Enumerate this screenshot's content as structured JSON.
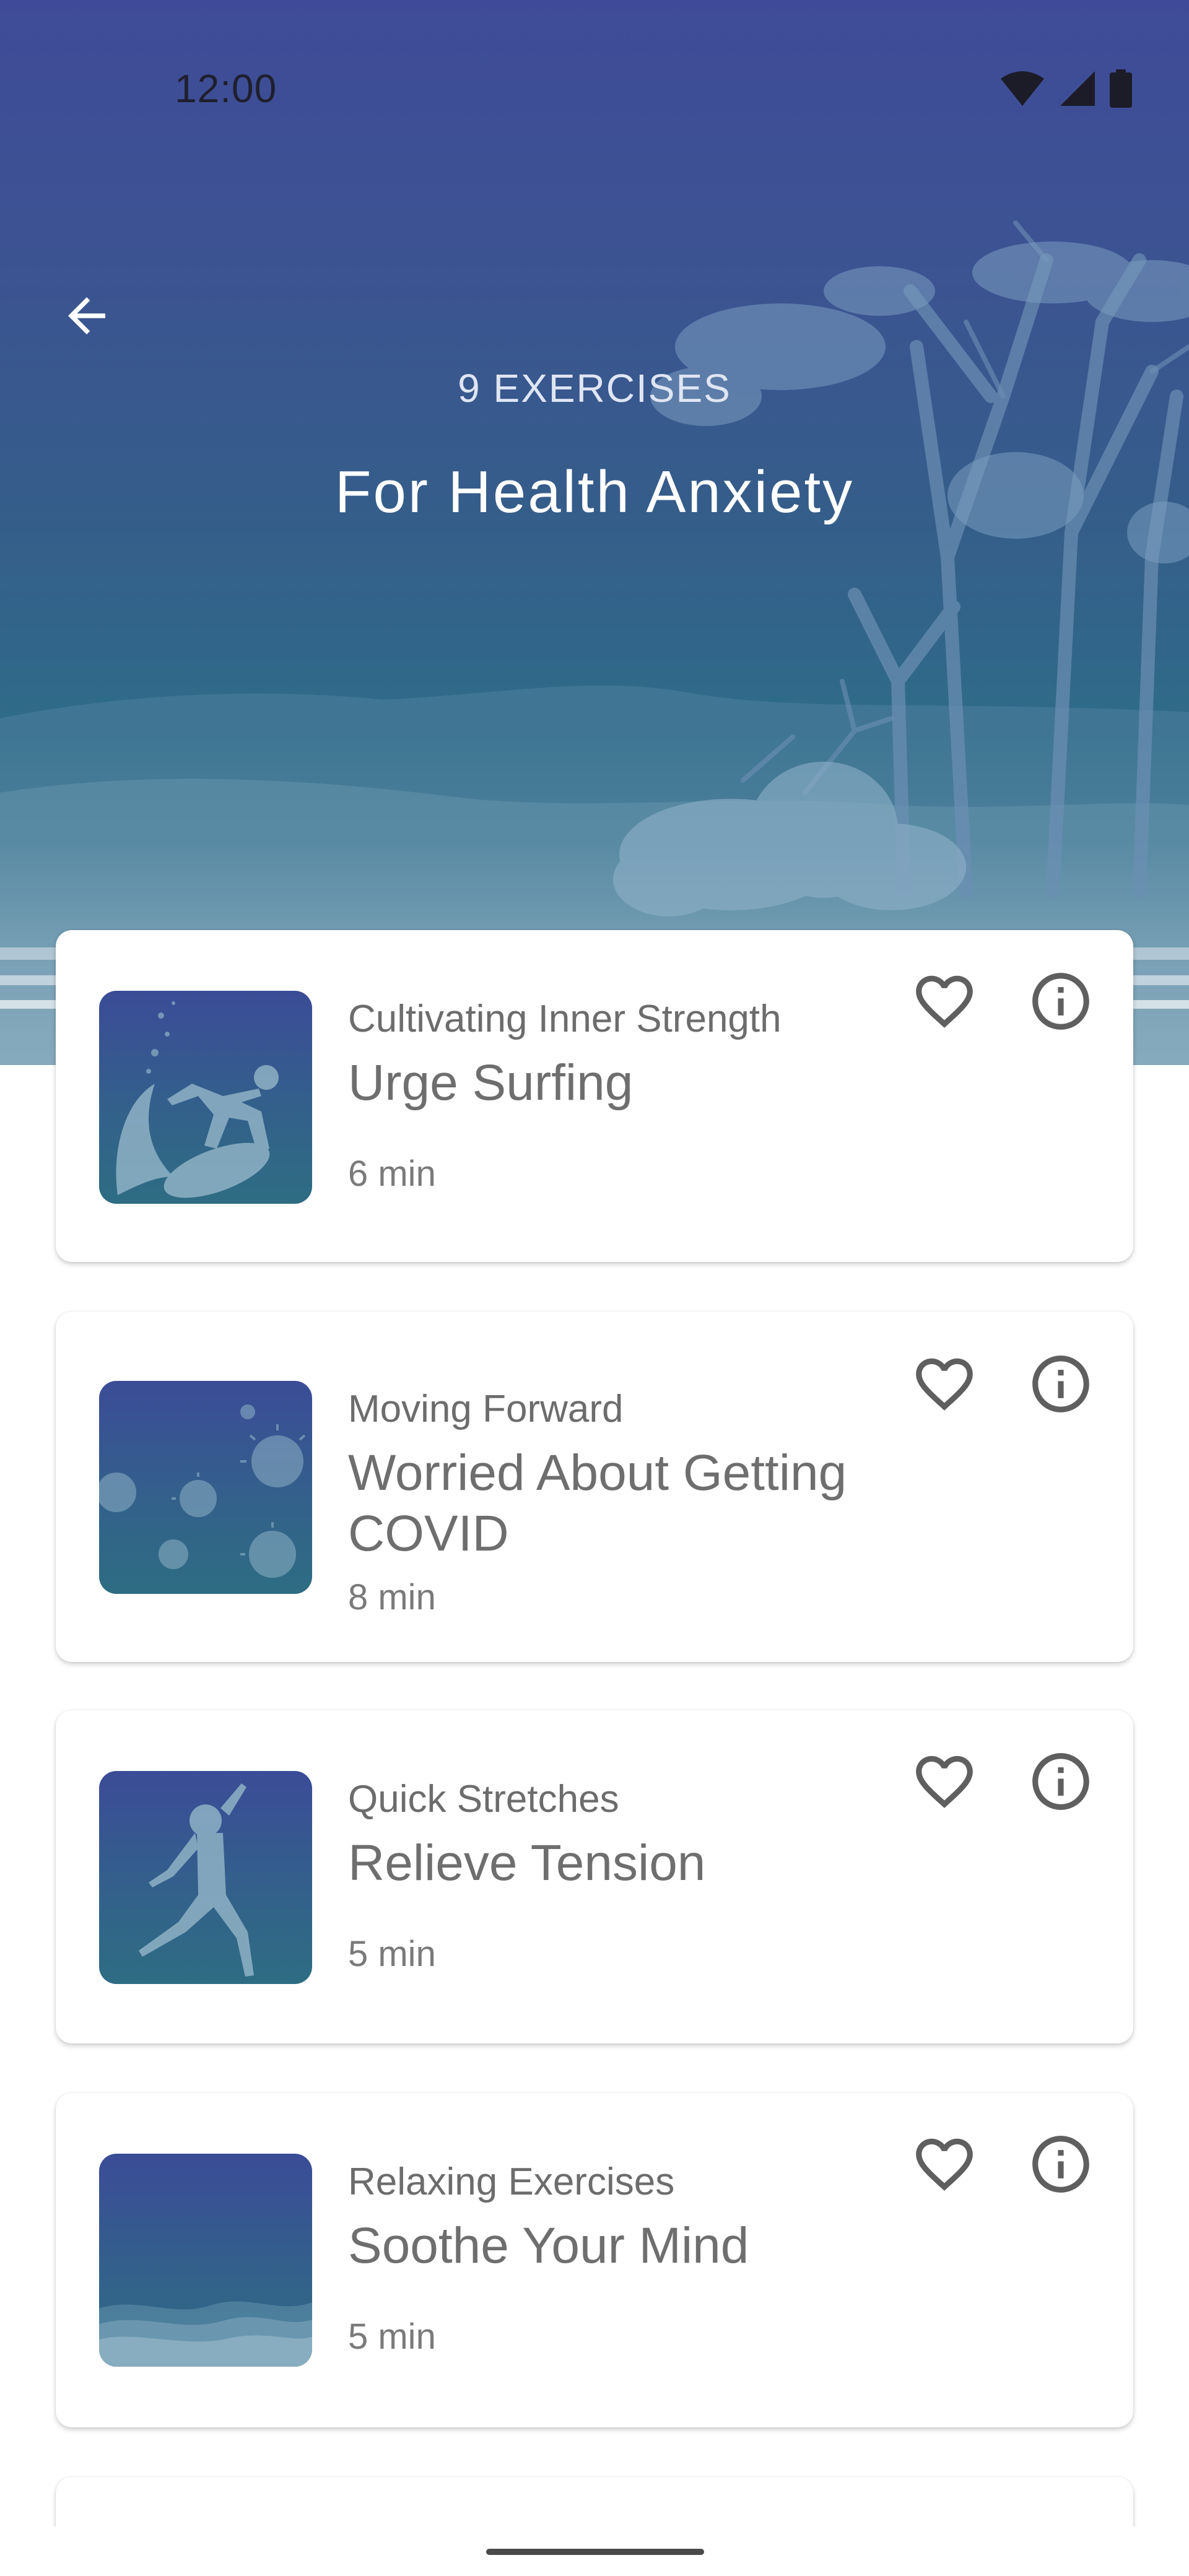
{
  "status_bar": {
    "time": "12:00",
    "icons": [
      "wifi-icon",
      "signal-icon",
      "battery-icon"
    ]
  },
  "header": {
    "back_icon": "arrow-left-icon",
    "exercise_count": "9 EXERCISES",
    "title": "For Health Anxiety"
  },
  "exercises": [
    {
      "category": "Cultivating Inner Strength",
      "title": "Urge Surfing",
      "duration": "6 min",
      "thumbnail_icon": "surfer-icon",
      "favorite_icon": "heart-outline-icon",
      "info_icon": "info-icon"
    },
    {
      "category": "Moving Forward",
      "title": "Worried About Getting COVID",
      "duration": "8 min",
      "thumbnail_icon": "virus-icon",
      "favorite_icon": "heart-outline-icon",
      "info_icon": "info-icon"
    },
    {
      "category": "Quick Stretches",
      "title": "Relieve Tension",
      "duration": "5 min",
      "thumbnail_icon": "jumping-person-icon",
      "favorite_icon": "heart-outline-icon",
      "info_icon": "info-icon"
    },
    {
      "category": "Relaxing Exercises",
      "title": "Soothe Your Mind",
      "duration": "5 min",
      "thumbnail_icon": "waves-icon",
      "favorite_icon": "heart-outline-icon",
      "info_icon": "info-icon"
    }
  ],
  "colors": {
    "header_top": "#3f4b98",
    "header_bottom": "#2f6d88",
    "card_text": "#6e6e6e",
    "icon_gray": "#5f5f5f"
  }
}
